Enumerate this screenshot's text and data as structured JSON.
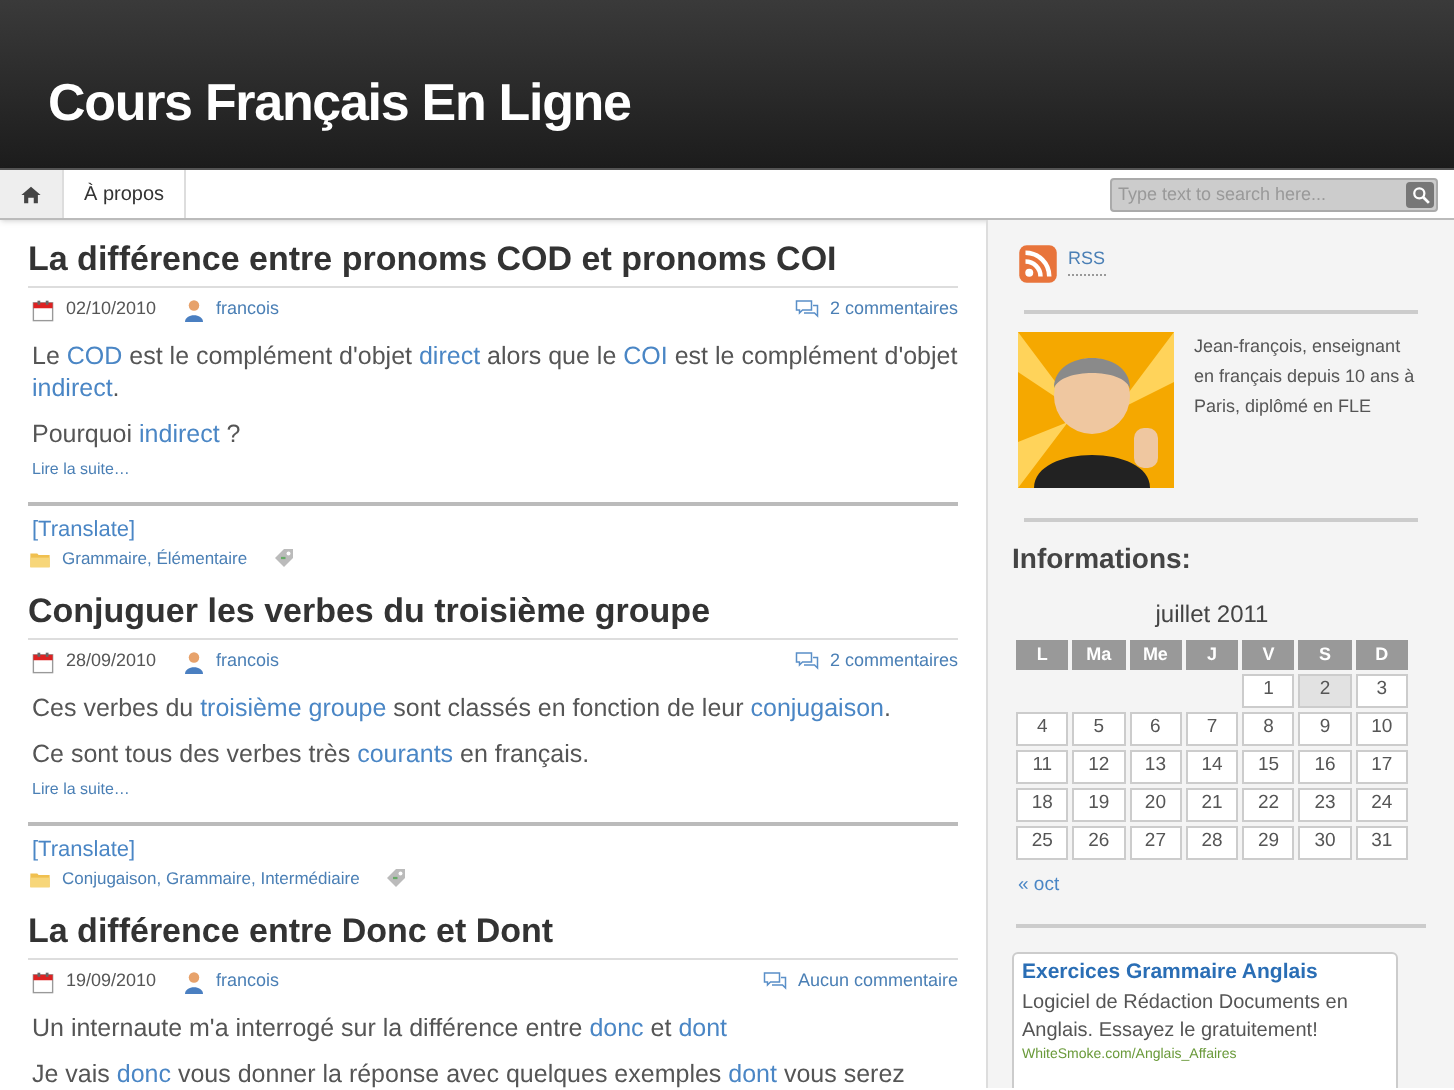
{
  "site": {
    "title": "Cours Français En Ligne"
  },
  "breadcrumb": [
    {
      "label": "À propos"
    }
  ],
  "search": {
    "placeholder": "Type text to search here..."
  },
  "posts": [
    {
      "title": "La différence entre pronoms COD et pronoms COI",
      "date": "02/10/2010",
      "author": "francois",
      "comments": "2 commentaires",
      "paragraphs": [
        [
          {
            "text": "Le ",
            "link": false
          },
          {
            "text": "COD",
            "link": true
          },
          {
            "text": " est le complément d'objet ",
            "link": false
          },
          {
            "text": "direct",
            "link": true
          },
          {
            "text": " alors que le ",
            "link": false
          },
          {
            "text": "COI",
            "link": true
          },
          {
            "text": " est le complément d'objet ",
            "link": false
          },
          {
            "text": "indirect",
            "link": true
          },
          {
            "text": ".",
            "link": false
          }
        ],
        [
          {
            "text": "Pourquoi ",
            "link": false
          },
          {
            "text": "indirect",
            "link": true
          },
          {
            "text": " ?",
            "link": false
          }
        ]
      ],
      "more": "Lire la suite…",
      "translate": "[Translate]",
      "categories": "Grammaire, Élémentaire"
    },
    {
      "title": "Conjuguer les verbes du troisième groupe",
      "date": "28/09/2010",
      "author": "francois",
      "comments": "2 commentaires",
      "paragraphs": [
        [
          {
            "text": "Ces verbes du ",
            "link": false
          },
          {
            "text": "troisième groupe",
            "link": true
          },
          {
            "text": " sont classés en fonction de leur ",
            "link": false
          },
          {
            "text": "conjugaison",
            "link": true
          },
          {
            "text": ".",
            "link": false
          }
        ],
        [
          {
            "text": "Ce sont tous des verbes très ",
            "link": false
          },
          {
            "text": "courants",
            "link": true
          },
          {
            "text": " en français.",
            "link": false
          }
        ]
      ],
      "more": "Lire la suite…",
      "translate": "[Translate]",
      "categories": "Conjugaison, Grammaire, Intermédiaire"
    },
    {
      "title": "La différence entre Donc et Dont",
      "date": "19/09/2010",
      "author": "francois",
      "comments": "Aucun commentaire",
      "paragraphs": [
        [
          {
            "text": "Un internaute m'a interrogé sur la différence entre ",
            "link": false
          },
          {
            "text": "donc",
            "link": true
          },
          {
            "text": " et ",
            "link": false
          },
          {
            "text": "dont",
            "link": true
          }
        ],
        [
          {
            "text": "Je vais ",
            "link": false
          },
          {
            "text": "donc",
            "link": true
          },
          {
            "text": " vous donner la réponse avec quelques exemples ",
            "link": false
          },
          {
            "text": "dont",
            "link": true
          },
          {
            "text": " vous serez",
            "link": false
          }
        ]
      ]
    }
  ],
  "sidebar": {
    "rss": "RSS",
    "bio": "Jean-françois, enseignant en français depuis 10 ans à Paris, diplômé en FLE",
    "informations_title": "Informations:",
    "calendar": {
      "month": "juillet 2011",
      "weekdays": [
        "L",
        "Ma",
        "Me",
        "J",
        "V",
        "S",
        "D"
      ],
      "weeks": [
        [
          {
            "day": "1",
            "selected": false
          },
          {
            "day": "2",
            "selected": true
          },
          {
            "day": "3",
            "selected": false
          }
        ],
        [
          {
            "day": "4",
            "selected": false
          },
          {
            "day": "5",
            "selected": false
          },
          {
            "day": "6",
            "selected": false
          },
          {
            "day": "7",
            "selected": false
          },
          {
            "day": "8",
            "selected": false
          },
          {
            "day": "9",
            "selected": false
          },
          {
            "day": "10",
            "selected": false
          }
        ],
        [
          {
            "day": "11",
            "selected": false
          },
          {
            "day": "12",
            "selected": false
          },
          {
            "day": "13",
            "selected": false
          },
          {
            "day": "14",
            "selected": false
          },
          {
            "day": "15",
            "selected": false
          },
          {
            "day": "16",
            "selected": false
          },
          {
            "day": "17",
            "selected": false
          }
        ],
        [
          {
            "day": "18",
            "selected": false
          },
          {
            "day": "19",
            "selected": false
          },
          {
            "day": "20",
            "selected": false
          },
          {
            "day": "21",
            "selected": false
          },
          {
            "day": "22",
            "selected": false
          },
          {
            "day": "23",
            "selected": false
          },
          {
            "day": "24",
            "selected": false
          }
        ],
        [
          {
            "day": "25",
            "selected": false
          },
          {
            "day": "26",
            "selected": false
          },
          {
            "day": "27",
            "selected": false
          },
          {
            "day": "28",
            "selected": false
          },
          {
            "day": "29",
            "selected": false
          },
          {
            "day": "30",
            "selected": false
          },
          {
            "day": "31",
            "selected": false
          }
        ]
      ],
      "prev": "« oct"
    },
    "ad": {
      "title": "Exercices Grammaire Anglais",
      "text": "Logiciel de Rédaction Documents en Anglais. Essayez le gratuitement!",
      "url": "WhiteSmoke.com/Anglais_Affaires"
    }
  }
}
